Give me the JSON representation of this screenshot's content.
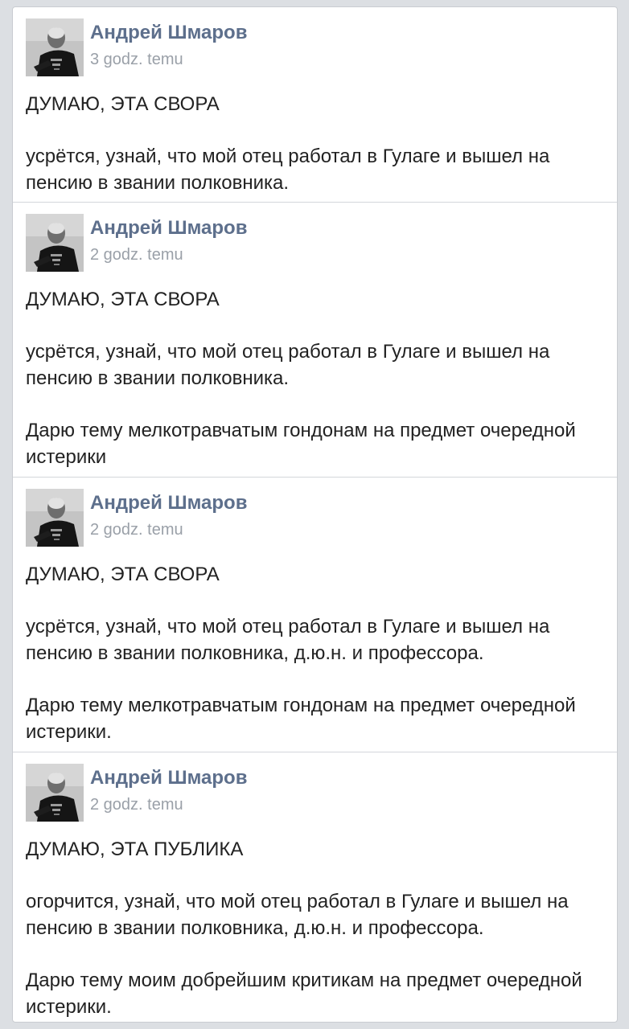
{
  "posts": [
    {
      "author": "Андрей Шмаров",
      "time": "3 godz. temu",
      "paragraphs": [
        "ДУМАЮ, ЭТА СВОРА",
        "усрётся, узнай, что мой отец работал в Гулаге и вышел на пенсию в звании полковника."
      ]
    },
    {
      "author": "Андрей Шмаров",
      "time": "2 godz. temu",
      "paragraphs": [
        "ДУМАЮ, ЭТА СВОРА",
        "усрётся, узнай, что мой отец работал в Гулаге и вышел на пенсию в звании полковника.",
        "Дарю тему мелкотравчатым гондонам на предмет очередной истерики"
      ]
    },
    {
      "author": "Андрей Шмаров",
      "time": "2 godz. temu",
      "paragraphs": [
        "ДУМАЮ, ЭТА СВОРА",
        "усрётся, узнай, что мой отец работал в Гулаге и вышел на пенсию в звании полковника, д.ю.н. и профессора.",
        "Дарю тему мелкотравчатым гондонам на предмет очередной истерики."
      ]
    },
    {
      "author": "Андрей Шмаров",
      "time": "2 godz. temu",
      "paragraphs": [
        "ДУМАЮ, ЭТА ПУБЛИКА",
        "огорчится, узнай, что мой отец работал в Гулаге и вышел на пенсию в звании полковника, д.ю.н. и профессора.",
        "Дарю тему моим добрейшим критикам на предмет очередной истерики."
      ]
    }
  ],
  "colors": {
    "author": "#5d6f8c",
    "time": "#9aa0a8",
    "text": "#222222",
    "background": "#dcdfe3"
  }
}
